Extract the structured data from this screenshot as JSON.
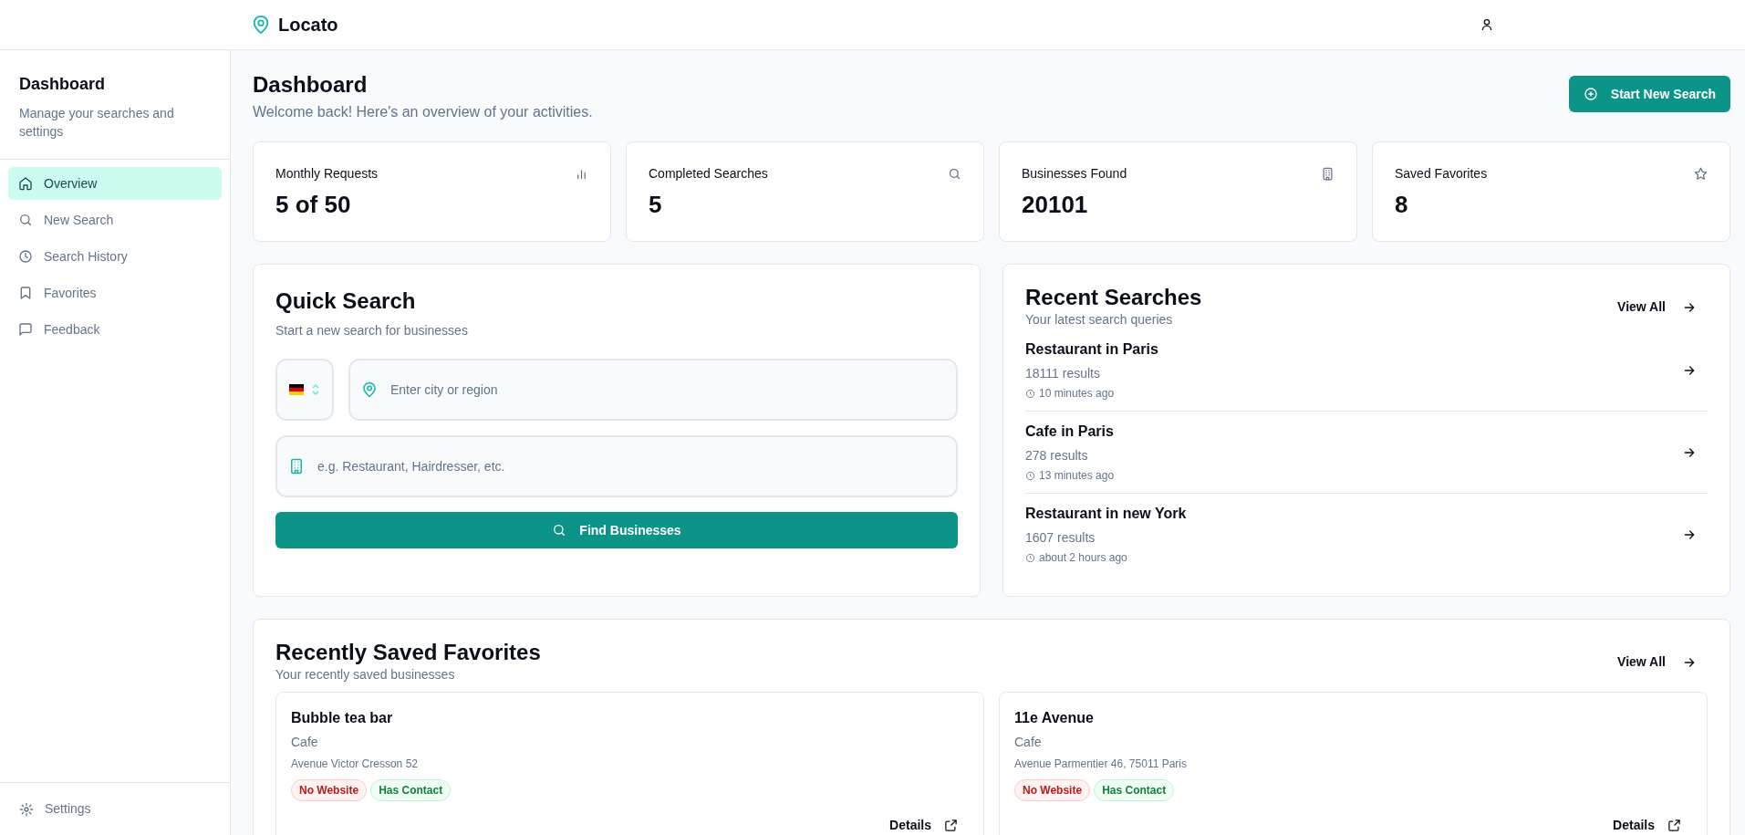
{
  "header": {
    "brand": "Locato"
  },
  "sidebar": {
    "title": "Dashboard",
    "subtitle": "Manage your searches and settings",
    "items": [
      {
        "label": "Overview",
        "kind": "home",
        "selected": true
      },
      {
        "label": "New Search",
        "kind": "search",
        "selected": false
      },
      {
        "label": "Search History",
        "kind": "clock",
        "selected": false
      },
      {
        "label": "Favorites",
        "kind": "bookmark",
        "selected": false
      },
      {
        "label": "Feedback",
        "kind": "message",
        "selected": false
      }
    ],
    "footer_item": {
      "label": "Settings",
      "kind": "gear"
    }
  },
  "page": {
    "title": "Dashboard",
    "subtitle": "Welcome back! Here's an overview of your activities.",
    "action": "Start New Search"
  },
  "stats": [
    {
      "label": "Monthly Requests",
      "value": "5 of 50",
      "kind": "chart"
    },
    {
      "label": "Completed Searches",
      "value": "5",
      "kind": "search"
    },
    {
      "label": "Businesses Found",
      "value": "20101",
      "kind": "building"
    },
    {
      "label": "Saved Favorites",
      "value": "8",
      "kind": "star"
    }
  ],
  "quick_search": {
    "title": "Quick Search",
    "subtitle": "Start a new search for businesses",
    "location_placeholder": "Enter city or region",
    "category_placeholder": "e.g. Restaurant, Hairdresser, etc.",
    "button": "Find Businesses"
  },
  "recent_searches": {
    "title": "Recent Searches",
    "subtitle": "Your latest search queries",
    "view_all": "View All",
    "items": [
      {
        "query": "Restaurant in Paris",
        "results": "18111 results",
        "time": "10 minutes ago"
      },
      {
        "query": "Cafe in Paris",
        "results": "278 results",
        "time": "13 minutes ago"
      },
      {
        "query": "Restaurant in new York",
        "results": "1607 results",
        "time": "about 2 hours ago"
      }
    ]
  },
  "favorites": {
    "title": "Recently Saved Favorites",
    "subtitle": "Your recently saved businesses",
    "view_all": "View All",
    "items": [
      {
        "name": "Bubble tea bar",
        "category": "Cafe",
        "address": "Avenue Victor Cresson 52",
        "tags": [
          {
            "label": "No Website",
            "kind": "negative"
          },
          {
            "label": "Has Contact",
            "kind": "positive"
          }
        ],
        "details": "Details"
      },
      {
        "name": "11e Avenue",
        "category": "Cafe",
        "address": "Avenue Parmentier 46, 75011 Paris",
        "tags": [
          {
            "label": "No Website",
            "kind": "negative"
          },
          {
            "label": "Has Contact",
            "kind": "positive"
          }
        ],
        "details": "Details"
      }
    ]
  }
}
